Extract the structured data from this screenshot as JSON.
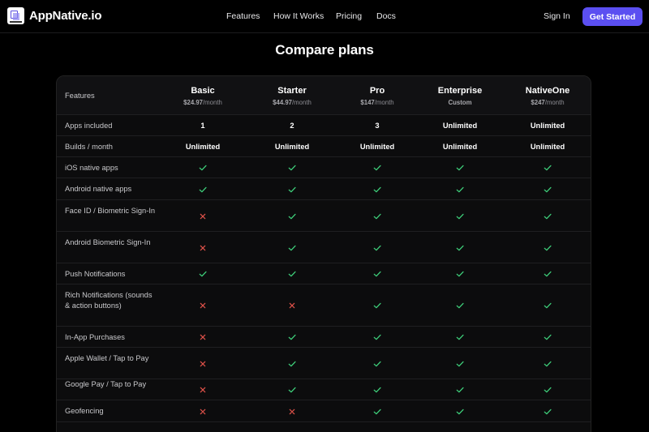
{
  "brand": {
    "name": "AppNative.io"
  },
  "nav": {
    "links": [
      "Features",
      "How It Works",
      "Pricing",
      "Docs"
    ],
    "signin": "Sign In",
    "cta": "Get Started"
  },
  "page": {
    "title": "Compare plans"
  },
  "table": {
    "header_label": "Features",
    "plans": [
      {
        "name": "Basic",
        "price": "$24.97",
        "period": "/month"
      },
      {
        "name": "Starter",
        "price": "$44.97",
        "period": "/month"
      },
      {
        "name": "Pro",
        "price": "$147",
        "period": "/month"
      },
      {
        "name": "Enterprise",
        "price": "Custom",
        "period": ""
      },
      {
        "name": "NativeOne",
        "price": "$247",
        "period": "/month"
      }
    ],
    "rows": [
      {
        "feature": "Apps included",
        "values": [
          "1",
          "2",
          "3",
          "Unlimited",
          "Unlimited"
        ]
      },
      {
        "feature": "Builds / month",
        "values": [
          "Unlimited",
          "Unlimited",
          "Unlimited",
          "Unlimited",
          "Unlimited"
        ]
      },
      {
        "feature": "iOS native apps",
        "values": [
          "check",
          "check",
          "check",
          "check",
          "check"
        ]
      },
      {
        "feature": "Android native apps",
        "values": [
          "check",
          "check",
          "check",
          "check",
          "check"
        ]
      },
      {
        "feature": "Face ID / Biometric Sign-In",
        "values": [
          "cross",
          "check",
          "check",
          "check",
          "check"
        ]
      },
      {
        "feature": "Android Biometric Sign-In",
        "values": [
          "cross",
          "check",
          "check",
          "check",
          "check"
        ]
      },
      {
        "feature": "Push Notifications",
        "values": [
          "check",
          "check",
          "check",
          "check",
          "check"
        ]
      },
      {
        "feature": "Rich Notifications (sounds & action buttons)",
        "values": [
          "cross",
          "cross",
          "check",
          "check",
          "check"
        ]
      },
      {
        "feature": "In-App Purchases",
        "values": [
          "cross",
          "check",
          "check",
          "check",
          "check"
        ]
      },
      {
        "feature": "Apple Wallet / Tap to Pay",
        "values": [
          "cross",
          "check",
          "check",
          "check",
          "check"
        ]
      },
      {
        "feature": "Google Pay / Tap to Pay",
        "values": [
          "cross",
          "check",
          "check",
          "check",
          "check"
        ]
      },
      {
        "feature": "Geofencing",
        "values": [
          "cross",
          "cross",
          "check",
          "check",
          "check"
        ]
      }
    ]
  },
  "colors": {
    "accent": "#5b4ff1",
    "check": "#3ecf7a",
    "cross": "#e0524a",
    "background": "#000000"
  }
}
